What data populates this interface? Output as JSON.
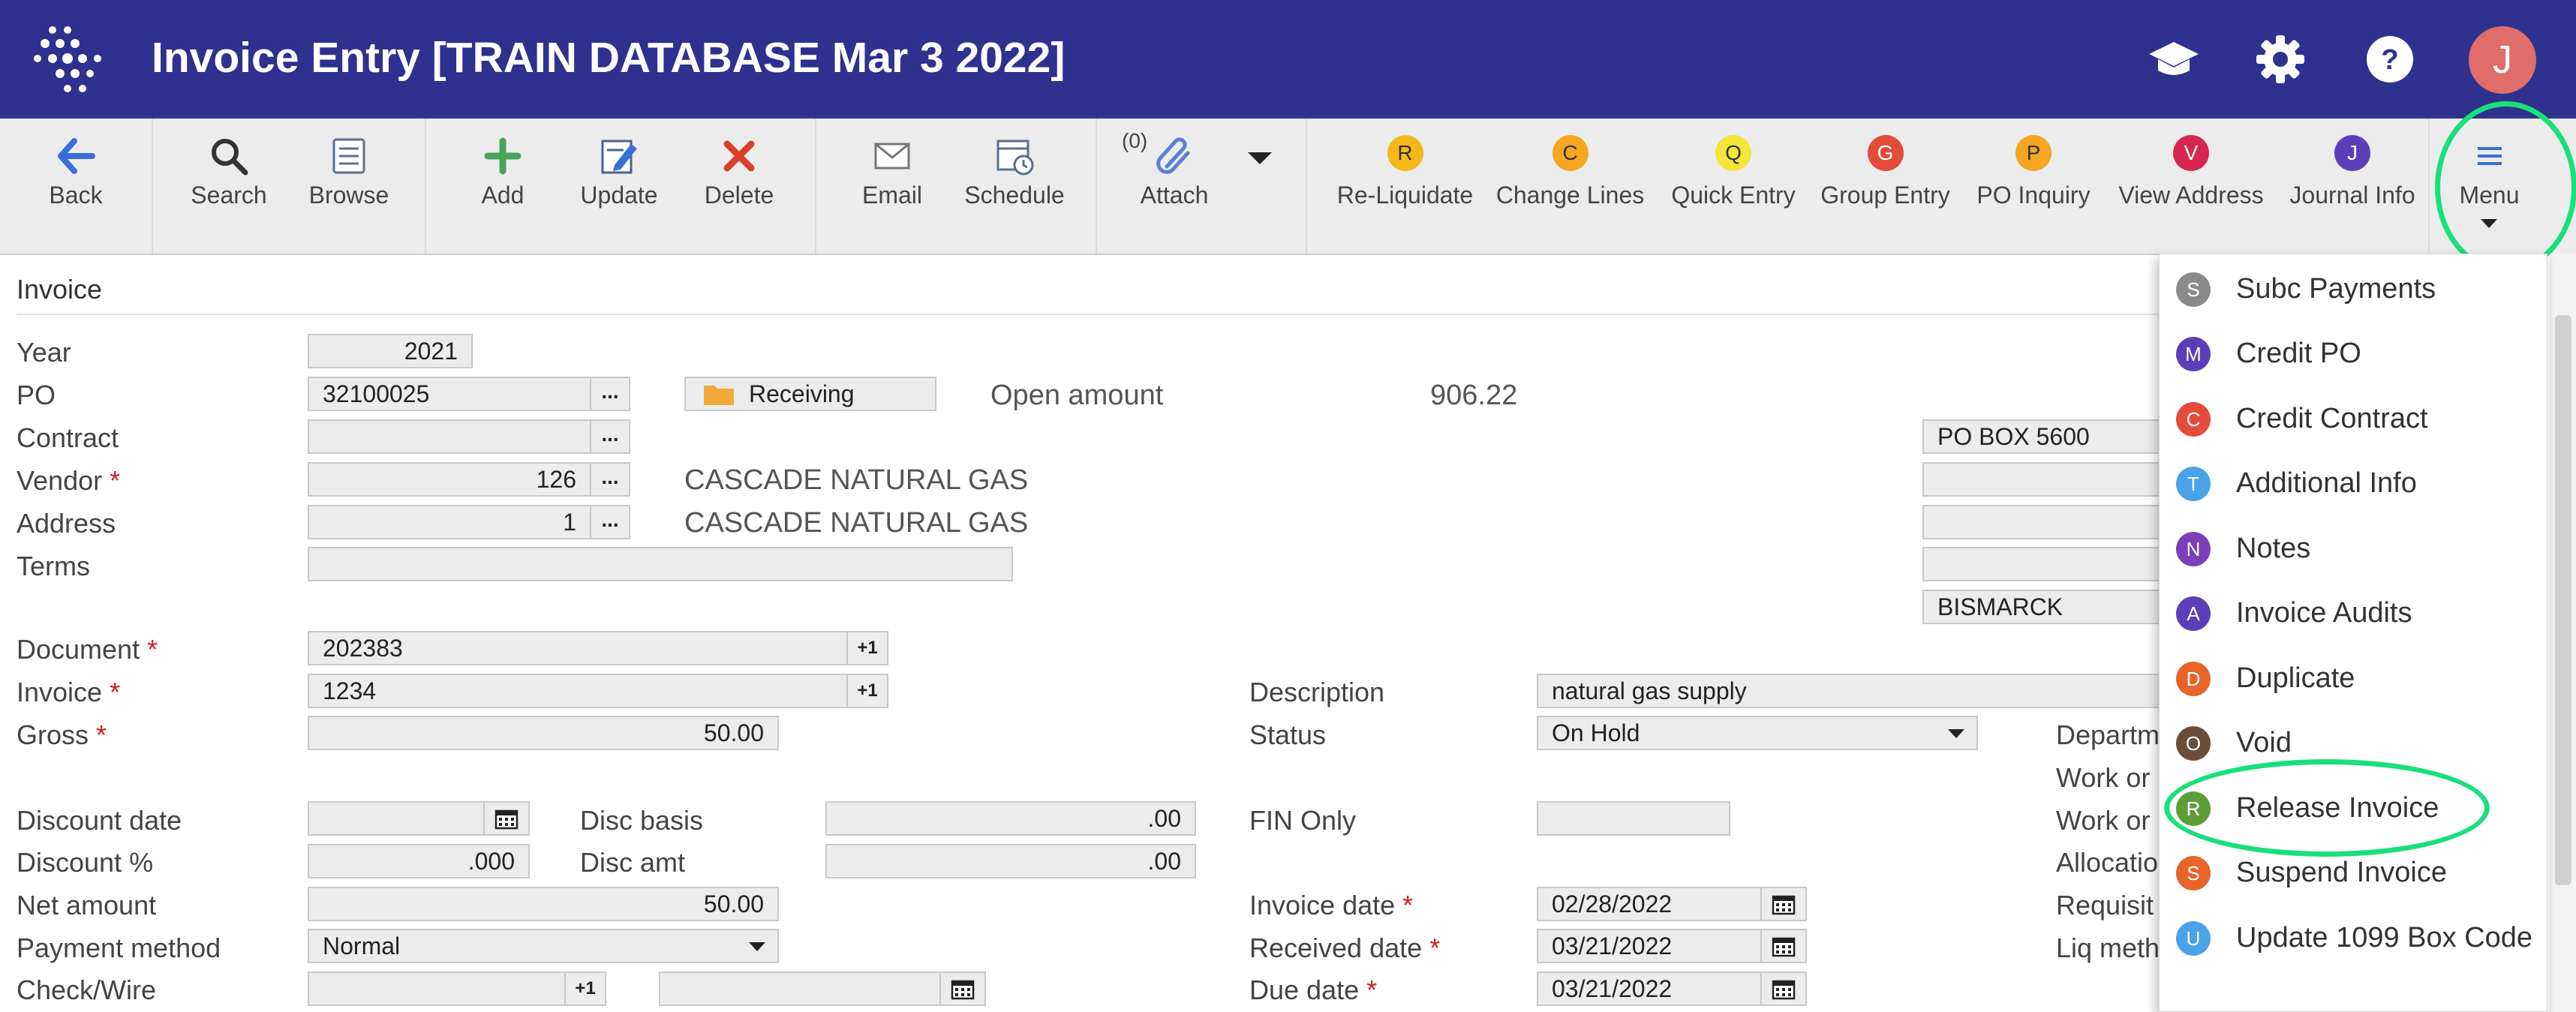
{
  "app": {
    "title": "Invoice Entry [TRAIN DATABASE Mar 3 2022]",
    "user_initial": "J"
  },
  "toolbar": {
    "back": "Back",
    "search": "Search",
    "browse": "Browse",
    "add": "Add",
    "update": "Update",
    "delete": "Delete",
    "email": "Email",
    "schedule": "Schedule",
    "attach": "Attach",
    "attach_count": "(0)",
    "menu": "Menu",
    "letter_buttons": [
      {
        "letter": "R",
        "label": "Re-Liquidate",
        "color": "#f5b81c"
      },
      {
        "letter": "C",
        "label": "Change Lines",
        "color": "#f5a623"
      },
      {
        "letter": "Q",
        "label": "Quick Entry",
        "color": "#f3e53a"
      },
      {
        "letter": "G",
        "label": "Group Entry",
        "color": "#e34b3a"
      },
      {
        "letter": "P",
        "label": "PO Inquiry",
        "color": "#f5a623"
      },
      {
        "letter": "V",
        "label": "View Address",
        "color": "#d7264f"
      },
      {
        "letter": "J",
        "label": "Journal Info",
        "color": "#5c3fb8"
      }
    ]
  },
  "section": {
    "title": "Invoice"
  },
  "form": {
    "year_label": "Year",
    "year": "2021",
    "po_label": "PO",
    "po": "32100025",
    "receiving": "Receiving",
    "open_amount_label": "Open amount",
    "open_amount": "906.22",
    "contract_label": "Contract",
    "contract": "",
    "vendor_label": "Vendor",
    "vendor": "126",
    "vendor_name": "CASCADE NATURAL GAS",
    "address_label": "Address",
    "address": "1",
    "address_name": "CASCADE NATURAL GAS",
    "terms_label": "Terms",
    "terms": "",
    "addr_line1": "PO BOX 5600",
    "addr_city": "BISMARCK",
    "document_label": "Document",
    "document": "202383",
    "invoice_label": "Invoice",
    "invoice": "1234",
    "gross_label": "Gross",
    "gross": "50.00",
    "description_label": "Description",
    "description": "natural gas supply",
    "status_label": "Status",
    "status": "On Hold",
    "discount_date_label": "Discount date",
    "discount_date": "",
    "disc_basis_label": "Disc basis",
    "disc_basis": ".00",
    "fin_only_label": "FIN Only",
    "fin_only": "",
    "discount_pct_label": "Discount %",
    "discount_pct": ".000",
    "disc_amt_label": "Disc amt",
    "disc_amt": ".00",
    "net_amount_label": "Net amount",
    "net_amount": "50.00",
    "invoice_date_label": "Invoice date",
    "invoice_date": "02/28/2022",
    "payment_method_label": "Payment method",
    "payment_method": "Normal",
    "received_date_label": "Received date",
    "received_date": "03/21/2022",
    "check_wire_label": "Check/Wire",
    "check_wire": "",
    "check_wire2": "",
    "due_date_label": "Due date",
    "due_date": "03/21/2022",
    "plus_one": "+1",
    "dots": "...",
    "right_labels": [
      "Departm",
      "Work or",
      "Work or",
      "Allocatio",
      "Requisit",
      "Liq meth"
    ]
  },
  "menu": {
    "items": [
      {
        "letter": "S",
        "label": "Subc Payments",
        "color": "#8a8a8a"
      },
      {
        "letter": "M",
        "label": "Credit PO",
        "color": "#5c3fb8"
      },
      {
        "letter": "C",
        "label": "Credit Contract",
        "color": "#e34b3a"
      },
      {
        "letter": "T",
        "label": "Additional Info",
        "color": "#4aa3e8"
      },
      {
        "letter": "N",
        "label": "Notes",
        "color": "#7b3fb8"
      },
      {
        "letter": "A",
        "label": "Invoice Audits",
        "color": "#5c3fb8"
      },
      {
        "letter": "D",
        "label": "Duplicate",
        "color": "#e8642a"
      },
      {
        "letter": "O",
        "label": "Void",
        "color": "#6b4e3a"
      },
      {
        "letter": "R",
        "label": "Release Invoice",
        "color": "#5e9e3a"
      },
      {
        "letter": "S",
        "label": "Suspend Invoice",
        "color": "#e8642a"
      },
      {
        "letter": "U",
        "label": "Update 1099 Box Code",
        "color": "#4aa3e8"
      }
    ]
  }
}
